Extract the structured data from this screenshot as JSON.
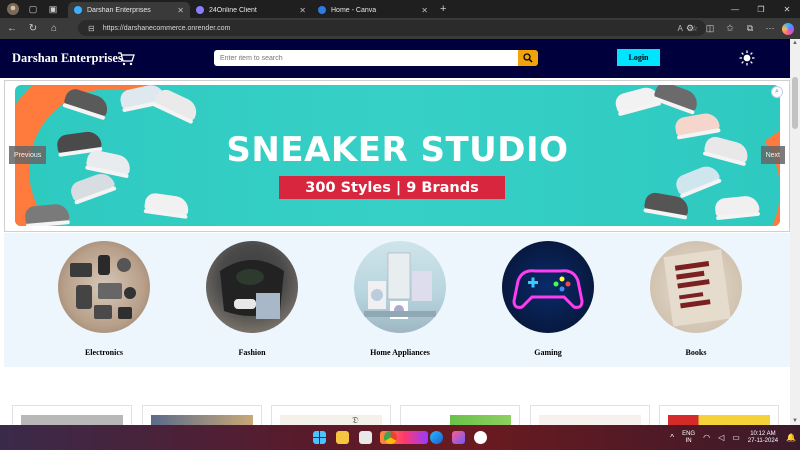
{
  "browser": {
    "tabs": [
      {
        "label": "Darshan Enterprises",
        "active": true,
        "favicon_color": "#3ab0ff"
      },
      {
        "label": "24Online Client",
        "active": false,
        "favicon_color": "#8a7dff"
      },
      {
        "label": "Home - Canva",
        "active": false,
        "favicon_color": "#2d7be5"
      }
    ],
    "url": "https://darshanecommerce.onrender.com"
  },
  "site": {
    "brand": "Darshan Enterprises",
    "search_placeholder": "Enter item to search",
    "login_label": "Login",
    "colors": {
      "header": "#00003d",
      "login": "#00e5ff",
      "search_button": "#f0a30a"
    }
  },
  "carousel": {
    "title": "SNEAKER STUDIO",
    "subtitle": "300 Styles | 9 Brands",
    "prev_label": "Previous",
    "next_label": "Next",
    "colors": {
      "background": "#2ec9c0",
      "swoosh": "#ff7a3d",
      "subtitle_bg": "#d7263d"
    }
  },
  "categories": [
    {
      "label": "Electronics"
    },
    {
      "label": "Fashion"
    },
    {
      "label": "Home Appliances"
    },
    {
      "label": "Gaming"
    },
    {
      "label": "Books"
    }
  ],
  "taskbar": {
    "language": "ENG",
    "region": "IN",
    "time": "10:12 AM",
    "date": "27-11-2024"
  }
}
